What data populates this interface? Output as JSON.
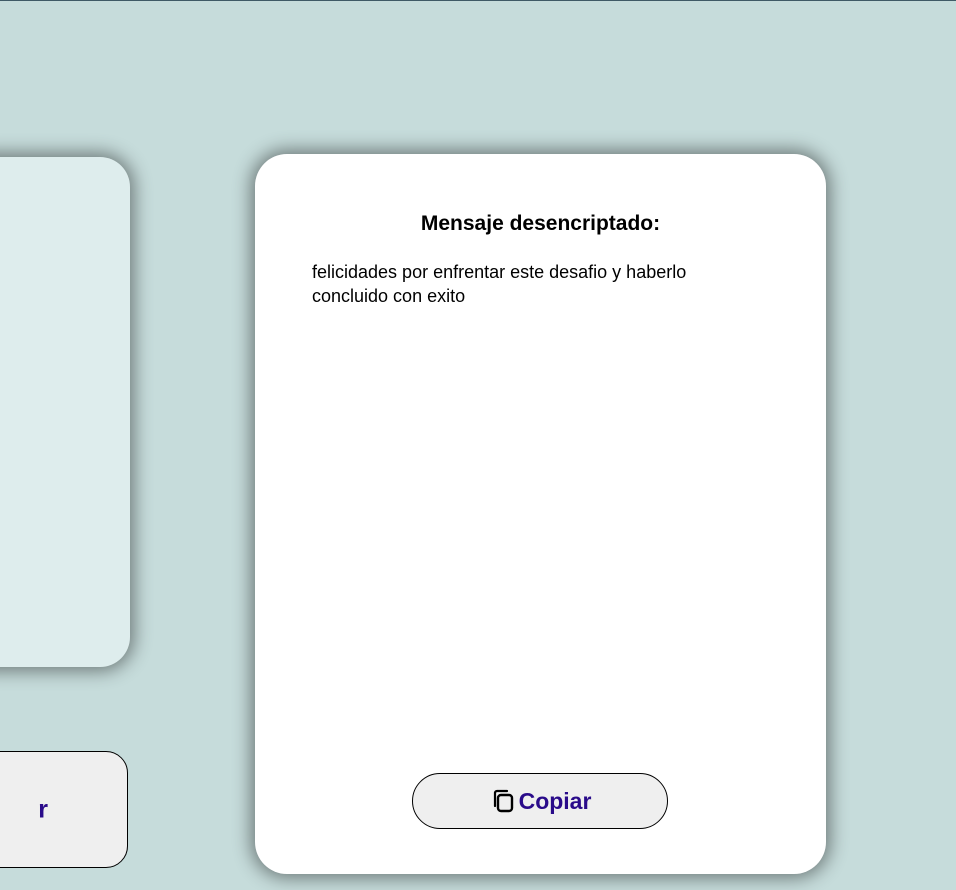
{
  "output_panel": {
    "title": "Mensaje desencriptado:",
    "message": "felicidades por enfrentar este desafio y haberlo concluido con exito",
    "copy_button": {
      "label": "Copiar",
      "icon": "copy-icon"
    }
  },
  "left_button": {
    "label_visible_fragment": "r"
  },
  "colors": {
    "background": "#c6dcdb",
    "input_panel": "#deeded",
    "output_panel": "#ffffff",
    "button_bg": "#efefef",
    "accent_text": "#2a0b8a"
  }
}
